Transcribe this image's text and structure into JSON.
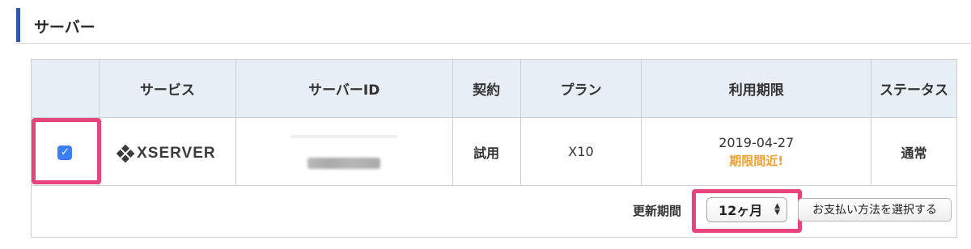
{
  "section": {
    "title": "サーバー"
  },
  "table": {
    "headers": [
      "",
      "サービス",
      "サーバーID",
      "契約",
      "プラン",
      "利用期限",
      "ステータス"
    ],
    "row": {
      "checked": true,
      "service_logo_text": "XSERVER",
      "contract": "試用",
      "plan": "X10",
      "expiry_date": "2019-04-27",
      "expiry_warning": "期限間近!",
      "status": "通常"
    }
  },
  "renewal": {
    "label": "更新期間",
    "period_value": "12ヶ月",
    "pay_button": "お支払い方法を選択する"
  },
  "colors": {
    "accent": "#2d5aa6",
    "highlight": "#e8437a",
    "header_bg": "#e7eef6",
    "warning": "#f0a030",
    "checkbox": "#3b7ef6"
  }
}
